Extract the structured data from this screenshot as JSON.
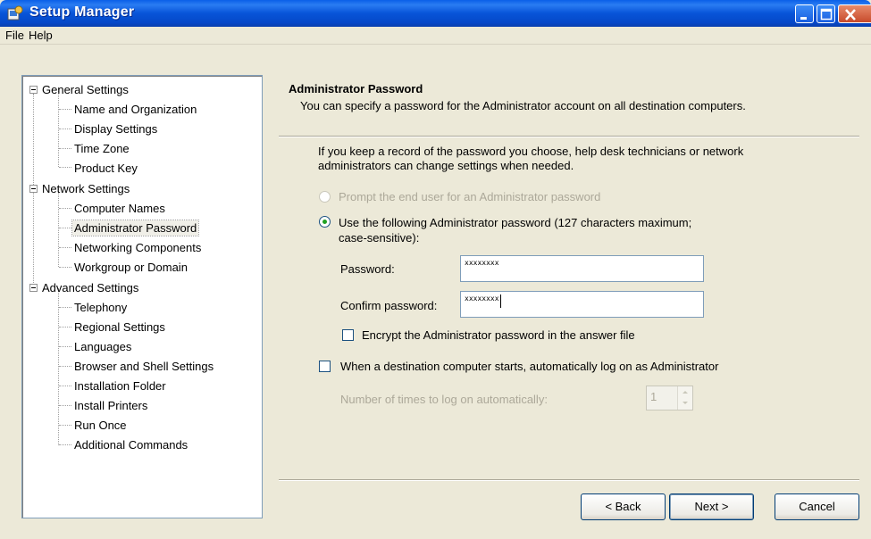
{
  "window": {
    "title": "Setup Manager"
  },
  "menu": {
    "file": "File",
    "help": "Help"
  },
  "tree": {
    "general": {
      "label": "General Settings",
      "items": [
        "Name and Organization",
        "Display Settings",
        "Time Zone",
        "Product Key"
      ]
    },
    "network": {
      "label": "Network Settings",
      "items": [
        "Computer Names",
        "Administrator Password",
        "Networking Components",
        "Workgroup or Domain"
      ]
    },
    "advanced": {
      "label": "Advanced Settings",
      "items": [
        "Telephony",
        "Regional Settings",
        "Languages",
        "Browser and Shell Settings",
        "Installation Folder",
        "Install Printers",
        "Run Once",
        "Additional Commands"
      ]
    },
    "selected": "Administrator Password"
  },
  "page": {
    "title": "Administrator Password",
    "description": "You can specify a password for the Administrator account on all destination computers.",
    "info_line1": "If you keep a record of the password you choose, help desk technicians or network",
    "info_line2": "administrators can change settings when needed.",
    "option_prompt": "Prompt the end user for an Administrator password",
    "option_use_line1": "Use the following Administrator password (127 characters maximum;",
    "option_use_line2": "case-sensitive):",
    "password_label": "Password:",
    "password_value": "xxxxxxxx",
    "confirm_label": "Confirm password:",
    "confirm_value": "xxxxxxxx",
    "encrypt_label": "Encrypt the Administrator password in the answer file",
    "autologon_label": "When a destination computer starts, automatically log on as Administrator",
    "times_label": "Number of times to log on automatically:",
    "times_value": "1"
  },
  "buttons": {
    "back": "< Back",
    "next": "Next >",
    "cancel": "Cancel"
  }
}
